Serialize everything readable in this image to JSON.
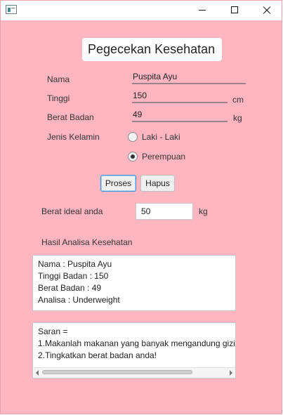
{
  "form": {
    "title": "Pegecekan Kesehatan",
    "nama_label": "Nama",
    "nama_value": "Puspita Ayu",
    "tinggi_label": "Tinggi",
    "tinggi_value": "150",
    "tinggi_unit": "cm",
    "berat_label": "Berat Badan",
    "berat_value": "49",
    "berat_unit": "kg",
    "gender_label": "Jenis Kelamin",
    "gender_options": [
      {
        "label": "Laki - Laki",
        "selected": false
      },
      {
        "label": "Perempuan",
        "selected": true
      }
    ],
    "proses_label": "Proses",
    "hapus_label": "Hapus",
    "ideal_label": "Berat ideal anda",
    "ideal_value": "50",
    "ideal_unit": "kg",
    "hasil_label": "Hasil Analisa Kesehatan"
  },
  "hasil": {
    "lines": [
      "Nama : Puspita Ayu",
      "Tinggi Badan : 150",
      "Berat Badan : 49",
      "Analisa : Underweight"
    ]
  },
  "saran": {
    "lines": [
      "Saran =",
      "1.Makanlah makanan yang banyak mengandung gizi",
      "2.Tingkatkan berat badan anda!"
    ]
  },
  "colors": {
    "background": "#ffb6c1",
    "accent": "#3c93d6"
  },
  "icons": [
    "app-icon",
    "minimize-icon",
    "maximize-icon",
    "close-icon",
    "scroll-left-icon",
    "scroll-right-icon"
  ]
}
